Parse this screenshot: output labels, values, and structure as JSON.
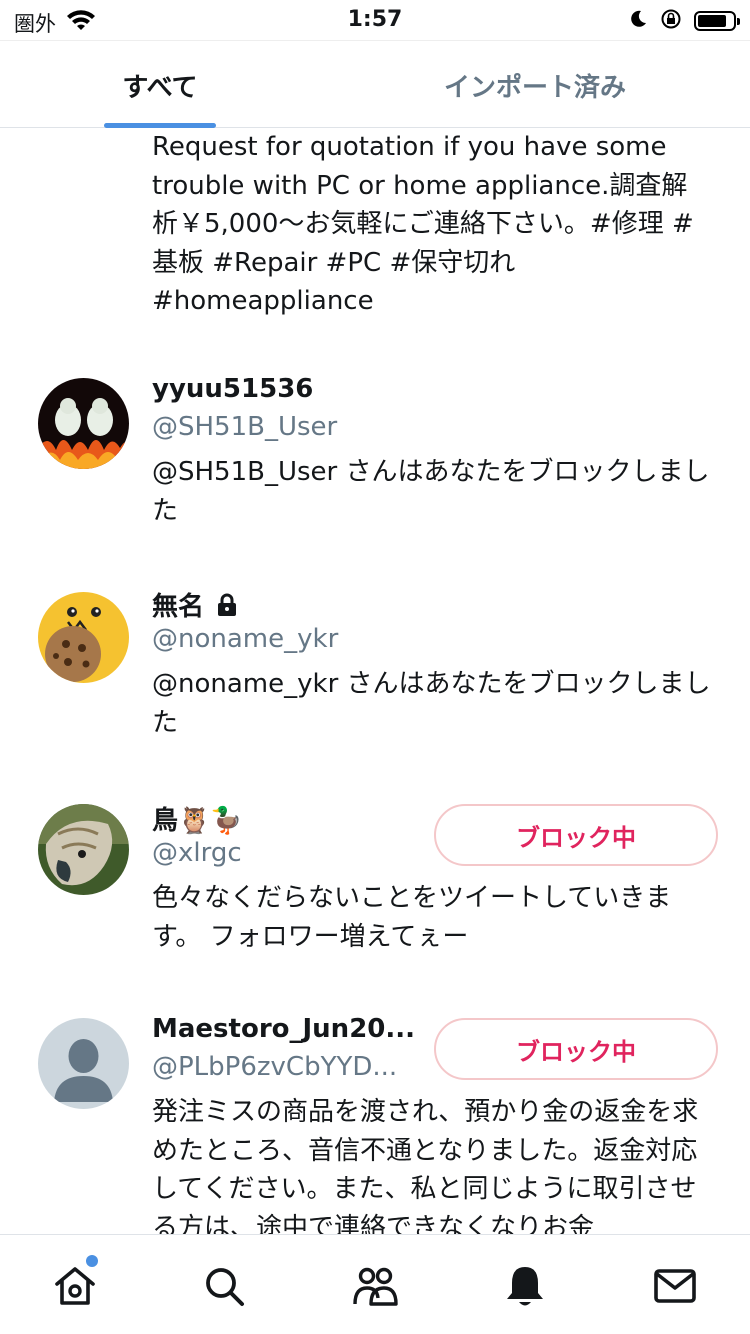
{
  "status_bar": {
    "carrier": "圏外",
    "time": "1:57",
    "icons": [
      "wifi-icon",
      "moon-icon",
      "orientation-lock-icon",
      "battery-icon"
    ]
  },
  "tabs": [
    {
      "label": "すべて",
      "selected": true
    },
    {
      "label": "インポート済み",
      "selected": false
    }
  ],
  "list": {
    "first_item_bio": "Request for quotation if you have some trouble with PC or home appliance.調査解析￥5,000～お気軽にご連絡下さい。#修理 #基板 #Repair #PC #保守切れ #homeappliance",
    "items": [
      {
        "name": "yyuu51536",
        "handle": "@SH51B_User",
        "bio": "@SH51B_User さんはあなたをブロックしました",
        "button": ""
      },
      {
        "name": "無名",
        "handle": "@noname_ykr",
        "bio": "@noname_ykr さんはあなたをブロックしました",
        "button": "",
        "locked": true
      },
      {
        "name": "鳥🦉🦆",
        "handle": "@xlrgc",
        "bio": "色々なくだらないことをツイートしていきます。 フォロワー増えてぇー",
        "button": "ブロック中"
      },
      {
        "name": "Maestoro_Jun20...",
        "handle": "@PLbP6zvCbYYD...",
        "bio": "発注ミスの商品を渡され、預かり金の返金を求めたところ、音信不通となりました。返金対応してください。また、私と同じように取引させる方は、途中で連絡できなくなりお金",
        "button": "ブロック中"
      }
    ]
  },
  "bottom_nav": [
    {
      "icon": "home-icon",
      "badge": true
    },
    {
      "icon": "search-icon"
    },
    {
      "icon": "people-icon"
    },
    {
      "icon": "bell-icon"
    },
    {
      "icon": "mail-icon"
    }
  ],
  "colors": {
    "accent": "#4a90e2",
    "block_red": "#e0245e",
    "secondary_text": "#657786"
  }
}
